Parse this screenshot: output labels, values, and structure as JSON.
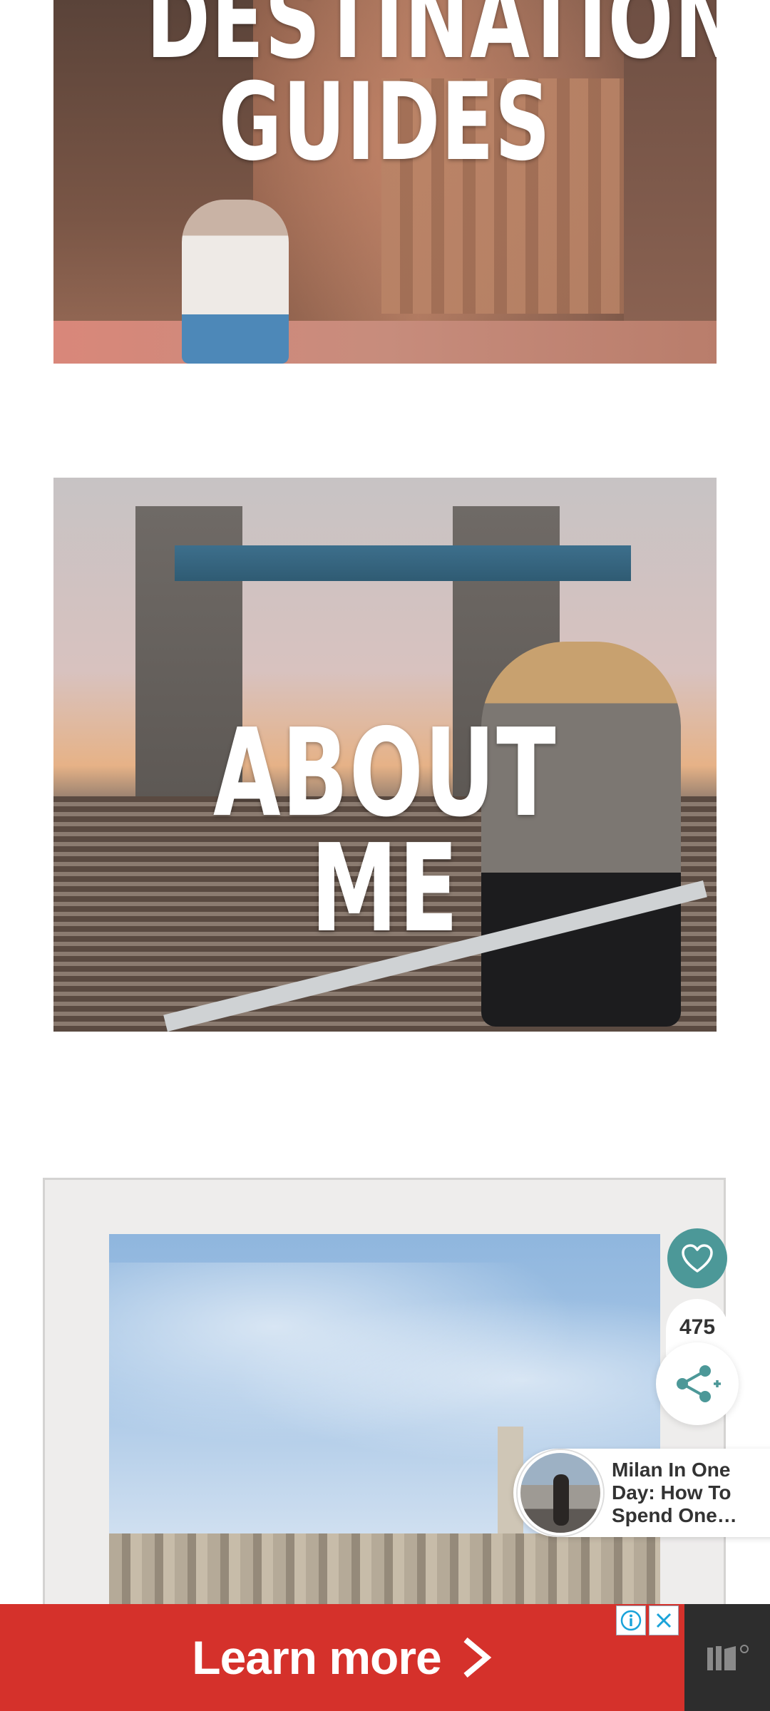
{
  "tiles": {
    "destination_guides": "DESTINATION GUIDES",
    "destination_guides_line1": "DESTINATION",
    "destination_guides_line2": "GUIDES",
    "about_me": "ABOUT ME"
  },
  "share_widget": {
    "like_icon": "heart-icon",
    "share_count": "475",
    "share_icon": "share-icon"
  },
  "related_post": {
    "title": "Milan In One Day: How To Spend One…"
  },
  "ad": {
    "cta_label": "Learn more",
    "cta_icon": "chevron-right-icon",
    "info_icon": "info-icon",
    "close_icon": "close-icon",
    "brand_icon": "brand-logo-icon",
    "background_color": "#d5312b"
  },
  "colors": {
    "accent": "#4c9898"
  }
}
